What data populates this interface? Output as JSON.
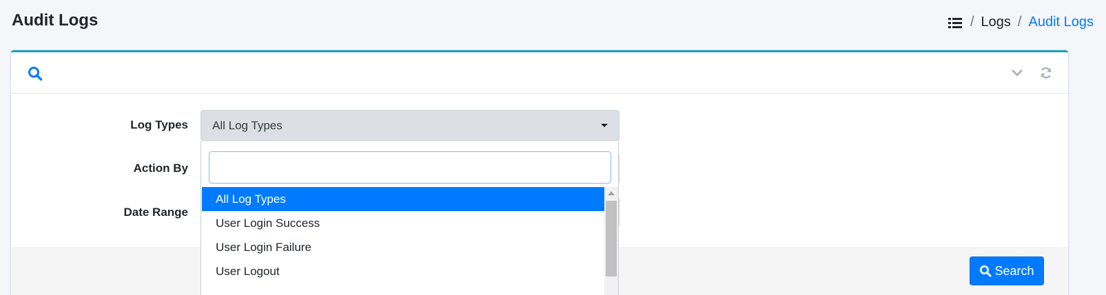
{
  "header": {
    "title": "Audit Logs",
    "breadcrumb": {
      "icon": "list-icon",
      "separator": "/",
      "items": [
        "Logs",
        "Audit Logs"
      ]
    }
  },
  "card": {
    "accent_color": "#17a2b8",
    "header_icons": [
      "search-icon",
      "chevron-down-icon",
      "refresh-icon"
    ]
  },
  "form": {
    "log_types_label": "Log Types",
    "action_by_label": "Action By",
    "date_range_label": "Date Range",
    "log_types_selected": "All Log Types",
    "dropdown": {
      "search_value": "",
      "options": [
        "All Log Types",
        "User Login Success",
        "User Login Failure",
        "User Logout"
      ],
      "selected_index": 0
    }
  },
  "footer": {
    "search_button_label": "Search"
  },
  "colors": {
    "primary": "#007bff",
    "select_bg": "#dcdfe5"
  }
}
